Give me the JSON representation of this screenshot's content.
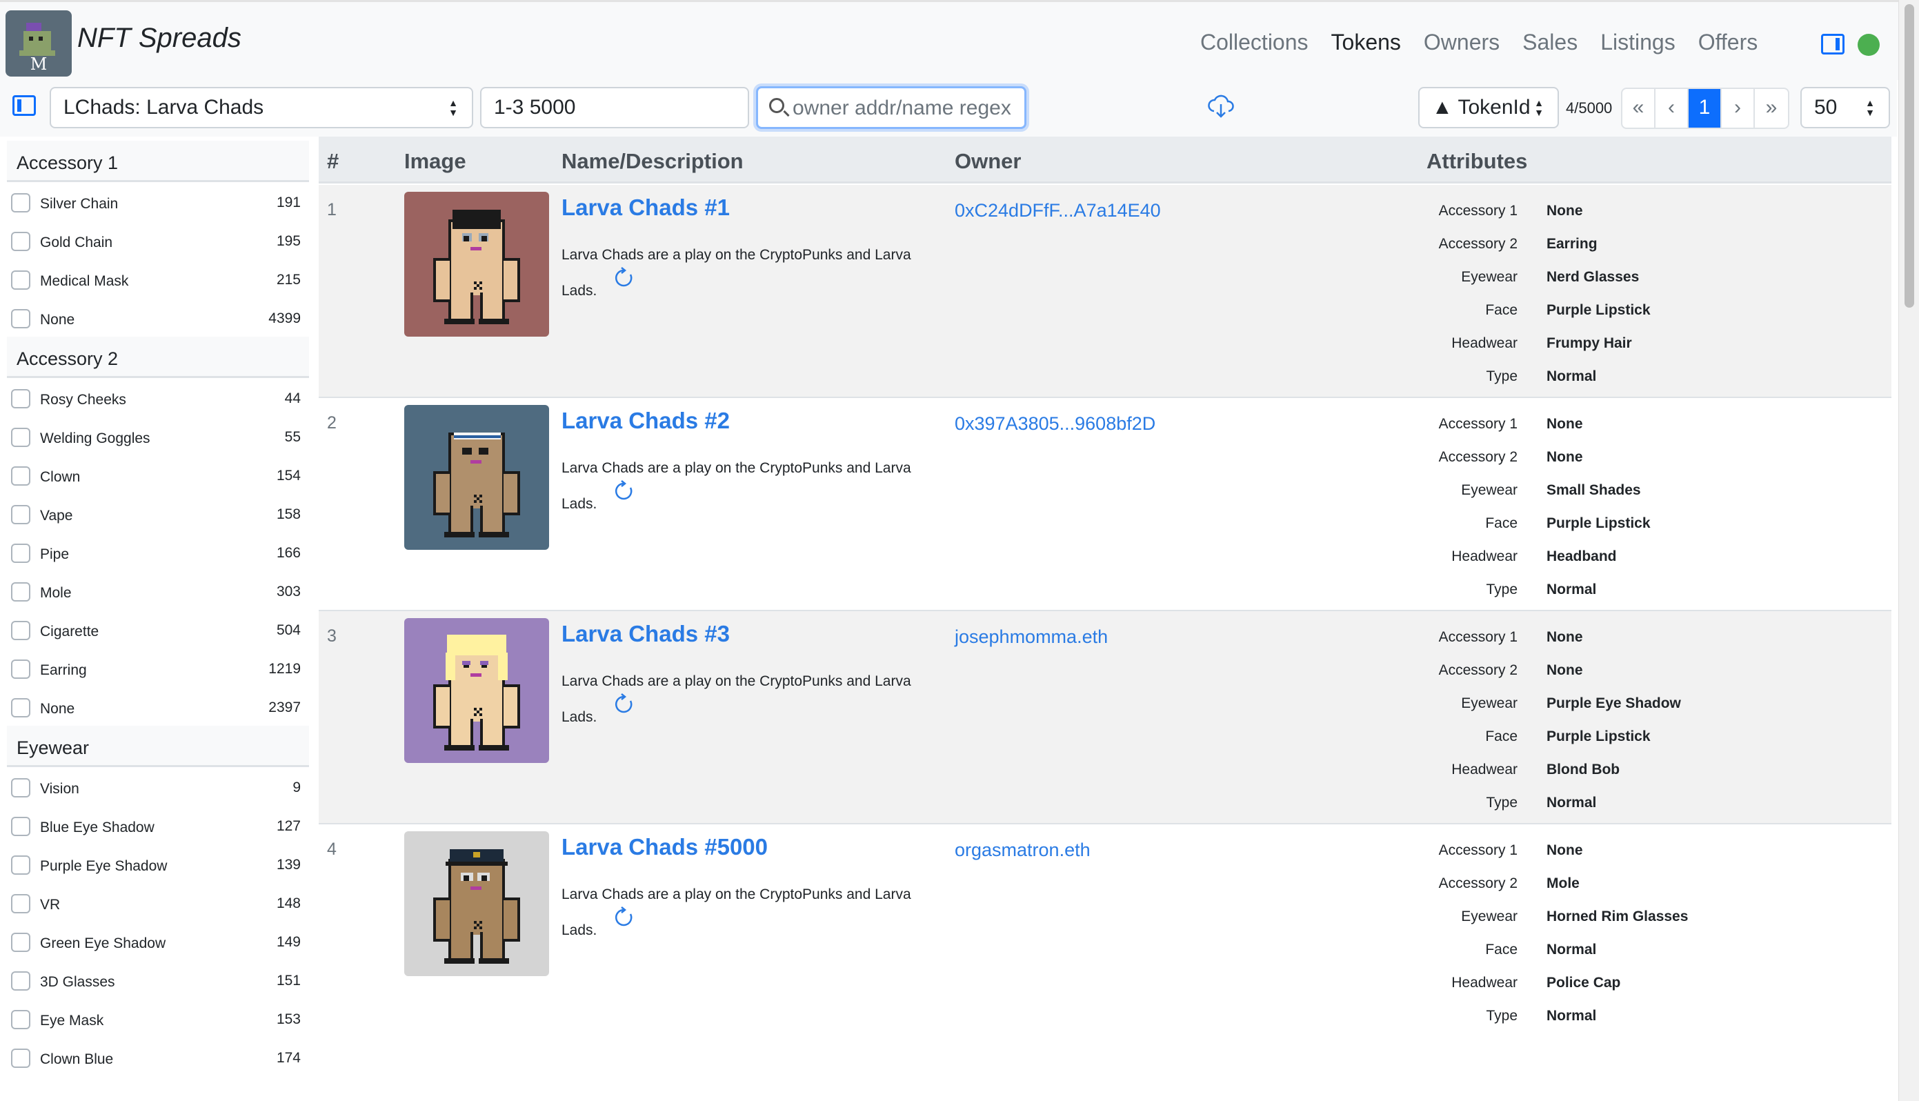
{
  "app": {
    "brand": "NFT Spreads",
    "logo_letter": "M"
  },
  "nav": {
    "items": [
      {
        "label": "Collections",
        "active": false
      },
      {
        "label": "Tokens",
        "active": true
      },
      {
        "label": "Owners",
        "active": false
      },
      {
        "label": "Sales",
        "active": false
      },
      {
        "label": "Listings",
        "active": false
      },
      {
        "label": "Offers",
        "active": false
      }
    ],
    "status_color": "#4caf50"
  },
  "toolbar": {
    "collection_value": "LChads: Larva Chads",
    "range_value": "1-3 5000",
    "search_placeholder": "owner addr/name regex",
    "sort_value": "▲ TokenId",
    "count": "4/5000",
    "pager": [
      "«",
      "‹",
      "1",
      "›",
      "»"
    ],
    "page_size": "50"
  },
  "table": {
    "headers": {
      "num": "#",
      "image": "Image",
      "name": "Name/Description",
      "owner": "Owner",
      "attributes": "Attributes"
    },
    "rows": [
      {
        "num": "1",
        "name": "Larva Chads #1",
        "description": "Larva Chads are a play on the CryptoPunks and Larva Lads.",
        "owner": "0xC24dDFfF...A7a14E40",
        "bg": "#9b6360",
        "skin": "#e7c39a",
        "attributes": [
          {
            "key": "Accessory 1",
            "value": "None"
          },
          {
            "key": "Accessory 2",
            "value": "Earring"
          },
          {
            "key": "Eyewear",
            "value": "Nerd Glasses"
          },
          {
            "key": "Face",
            "value": "Purple Lipstick"
          },
          {
            "key": "Headwear",
            "value": "Frumpy Hair"
          },
          {
            "key": "Type",
            "value": "Normal"
          }
        ]
      },
      {
        "num": "2",
        "name": "Larva Chads #2",
        "description": "Larva Chads are a play on the CryptoPunks and Larva Lads.",
        "owner": "0x397A3805...9608bf2D",
        "bg": "#4f6b80",
        "skin": "#b0906c",
        "attributes": [
          {
            "key": "Accessory 1",
            "value": "None"
          },
          {
            "key": "Accessory 2",
            "value": "None"
          },
          {
            "key": "Eyewear",
            "value": "Small Shades"
          },
          {
            "key": "Face",
            "value": "Purple Lipstick"
          },
          {
            "key": "Headwear",
            "value": "Headband"
          },
          {
            "key": "Type",
            "value": "Normal"
          }
        ]
      },
      {
        "num": "3",
        "name": "Larva Chads #3",
        "description": "Larva Chads are a play on the CryptoPunks and Larva Lads.",
        "owner": "josephmomma.eth",
        "bg": "#9a82bd",
        "skin": "#f0d2a6",
        "attributes": [
          {
            "key": "Accessory 1",
            "value": "None"
          },
          {
            "key": "Accessory 2",
            "value": "None"
          },
          {
            "key": "Eyewear",
            "value": "Purple Eye Shadow"
          },
          {
            "key": "Face",
            "value": "Purple Lipstick"
          },
          {
            "key": "Headwear",
            "value": "Blond Bob"
          },
          {
            "key": "Type",
            "value": "Normal"
          }
        ]
      },
      {
        "num": "4",
        "name": "Larva Chads #5000",
        "description": "Larva Chads are a play on the CryptoPunks and Larva Lads.",
        "owner": "orgasmatron.eth",
        "bg": "#d4d4d4",
        "skin": "#a8865e",
        "attributes": [
          {
            "key": "Accessory 1",
            "value": "None"
          },
          {
            "key": "Accessory 2",
            "value": "Mole"
          },
          {
            "key": "Eyewear",
            "value": "Horned Rim Glasses"
          },
          {
            "key": "Face",
            "value": "Normal"
          },
          {
            "key": "Headwear",
            "value": "Police Cap"
          },
          {
            "key": "Type",
            "value": "Normal"
          }
        ]
      }
    ]
  },
  "facets": [
    {
      "title": "Accessory 1",
      "items": [
        {
          "label": "Silver Chain",
          "count": "191"
        },
        {
          "label": "Gold Chain",
          "count": "195"
        },
        {
          "label": "Medical Mask",
          "count": "215"
        },
        {
          "label": "None",
          "count": "4399"
        }
      ]
    },
    {
      "title": "Accessory 2",
      "items": [
        {
          "label": "Rosy Cheeks",
          "count": "44"
        },
        {
          "label": "Welding Goggles",
          "count": "55"
        },
        {
          "label": "Clown",
          "count": "154"
        },
        {
          "label": "Vape",
          "count": "158"
        },
        {
          "label": "Pipe",
          "count": "166"
        },
        {
          "label": "Mole",
          "count": "303"
        },
        {
          "label": "Cigarette",
          "count": "504"
        },
        {
          "label": "Earring",
          "count": "1219"
        },
        {
          "label": "None",
          "count": "2397"
        }
      ]
    },
    {
      "title": "Eyewear",
      "items": [
        {
          "label": "Vision",
          "count": "9"
        },
        {
          "label": "Blue Eye Shadow",
          "count": "127"
        },
        {
          "label": "Purple Eye Shadow",
          "count": "139"
        },
        {
          "label": "VR",
          "count": "148"
        },
        {
          "label": "Green Eye Shadow",
          "count": "149"
        },
        {
          "label": "3D Glasses",
          "count": "151"
        },
        {
          "label": "Eye Mask",
          "count": "153"
        },
        {
          "label": "Clown Blue",
          "count": "174"
        }
      ]
    }
  ]
}
